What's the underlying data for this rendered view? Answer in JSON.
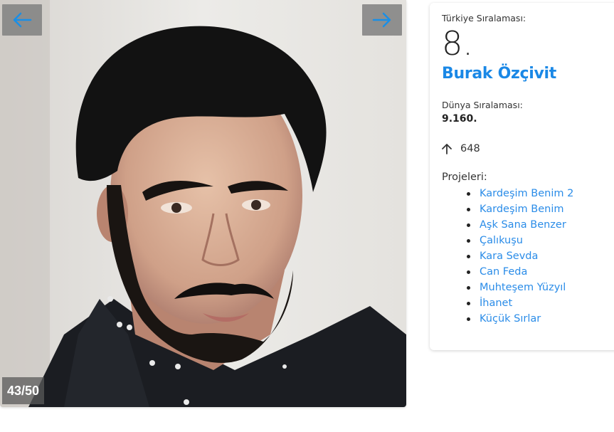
{
  "gallery": {
    "prev_icon": "arrow-left-icon",
    "next_icon": "arrow-right-icon",
    "counter": "43/50",
    "accent_color": "#1a8fe6"
  },
  "profile": {
    "turkey_rank_label": "Türkiye Sıralaması:",
    "turkey_rank": "8.",
    "name": "Burak Özçivit",
    "world_rank_label": "Dünya Sıralaması:",
    "world_rank": "9.160.",
    "trend_icon": "arrow-up-icon",
    "trend_value": "648",
    "projects_label": "Projeleri:",
    "projects": [
      "Kardeşim Benim 2",
      "Kardeşim Benim",
      "Aşk Sana Benzer",
      "Çalıkuşu",
      "Kara Sevda",
      "Can Feda",
      "Muhteşem Yüzyıl",
      "İhanet",
      "Küçük Sırlar"
    ],
    "link_color": "#2a8ce8"
  }
}
